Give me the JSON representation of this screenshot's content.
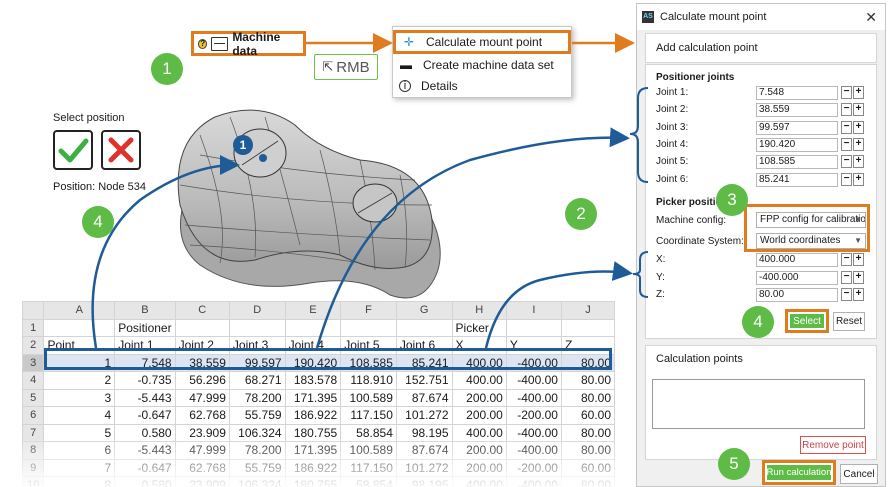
{
  "tree": {
    "machine_data_label": "Machine data",
    "rmb_label": "RMB"
  },
  "context_menu": {
    "items": [
      {
        "label": "Calculate mount point",
        "icon": "crosshair-icon"
      },
      {
        "label": "Create machine data set",
        "icon": "folder-icon"
      },
      {
        "label": "Details",
        "icon": "info-icon"
      }
    ]
  },
  "badges": [
    "1",
    "2",
    "3",
    "4",
    "4",
    "5"
  ],
  "viewport": {
    "marker": "1"
  },
  "select_position": {
    "title": "Select position",
    "position_label": "Position:",
    "position_value": "Node 534"
  },
  "sheet": {
    "col_headers": [
      "A",
      "B",
      "C",
      "D",
      "E",
      "F",
      "G",
      "H",
      "I",
      "J"
    ],
    "row_headers": [
      "1",
      "2",
      "3",
      "4",
      "5",
      "6",
      "7",
      "8",
      "9",
      "10"
    ],
    "row1": [
      "",
      "Positioner",
      "",
      "",
      "",
      "",
      "",
      "Picker",
      "",
      ""
    ],
    "row2": [
      "Point",
      "Joint 1",
      "Joint 2",
      "Joint 3",
      "Joint 4",
      "Joint 5",
      "Joint 6",
      "X",
      "Y",
      "Z"
    ],
    "data": [
      [
        "1",
        "7.548",
        "38.559",
        "99.597",
        "190.420",
        "108.585",
        "85.241",
        "400.00",
        "-400.00",
        "80.00"
      ],
      [
        "2",
        "-0.735",
        "56.296",
        "68.271",
        "183.578",
        "118.910",
        "152.751",
        "400.00",
        "-400.00",
        "80.00"
      ],
      [
        "3",
        "-5.443",
        "47.999",
        "78.200",
        "171.395",
        "100.589",
        "87.674",
        "200.00",
        "-400.00",
        "80.00"
      ],
      [
        "4",
        "-0.647",
        "62.768",
        "55.759",
        "186.922",
        "117.150",
        "101.272",
        "200.00",
        "-200.00",
        "60.00"
      ],
      [
        "5",
        "0.580",
        "23.909",
        "106.324",
        "180.755",
        "58.854",
        "98.195",
        "400.00",
        "-400.00",
        "80.00"
      ],
      [
        "6",
        "-5.443",
        "47.999",
        "78.200",
        "171.395",
        "100.589",
        "87.674",
        "200.00",
        "-400.00",
        "80.00"
      ],
      [
        "7",
        "-0.647",
        "62.768",
        "55.759",
        "186.922",
        "117.150",
        "101.272",
        "200.00",
        "-200.00",
        "60.00"
      ],
      [
        "8",
        "0.580",
        "23.909",
        "106.324",
        "180.755",
        "58.854",
        "98.195",
        "400.00",
        "-400.00",
        "80.00"
      ]
    ]
  },
  "dialog": {
    "title": "Calculate mount point",
    "add_section": "Add calculation point",
    "positioner_joints": "Positioner joints",
    "joints": [
      {
        "label": "Joint 1:",
        "value": "7.548"
      },
      {
        "label": "Joint 2:",
        "value": "38.559"
      },
      {
        "label": "Joint 3:",
        "value": "99.597"
      },
      {
        "label": "Joint 4:",
        "value": "190.420"
      },
      {
        "label": "Joint 5:",
        "value": "108.585"
      },
      {
        "label": "Joint 6:",
        "value": "85.241"
      }
    ],
    "picker_position": "Picker position",
    "machine_config_label": "Machine config:",
    "machine_config_value": "FPP config for calibration",
    "coord_system_label": "Coordinate System:",
    "coord_system_value": "World coordinates",
    "coords": [
      {
        "label": "X:",
        "value": "400.000"
      },
      {
        "label": "Y:",
        "value": "-400.000"
      },
      {
        "label": "Z:",
        "value": "80.00"
      }
    ],
    "select_btn": "Select",
    "reset_btn": "Reset",
    "calc_points": "Calculation points",
    "remove_btn": "Remove point",
    "run_btn": "Run calculation",
    "cancel_btn": "Cancel"
  },
  "colors": {
    "accent_orange": "#e07b1e",
    "badge_green": "#5dbb46",
    "arrow_blue": "#1f5b97"
  }
}
